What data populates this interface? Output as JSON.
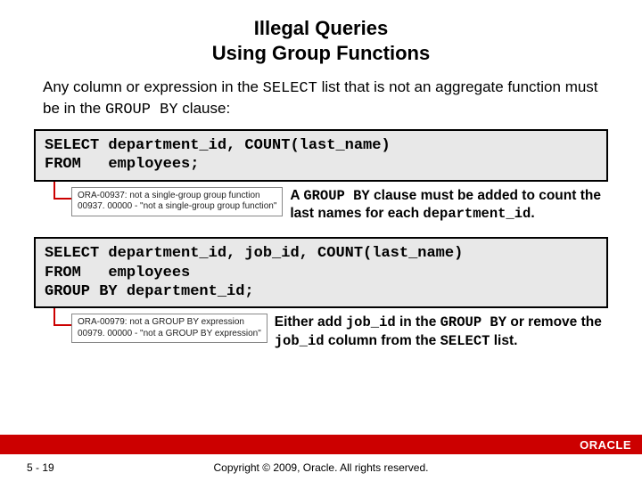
{
  "title_line1": "Illegal Queries",
  "title_line2": "Using Group Functions",
  "intro_pre": "Any column or expression in the ",
  "intro_code1": "SELECT",
  "intro_mid": " list that is not an aggregate function must be in the ",
  "intro_code2": "GROUP BY",
  "intro_post": " clause:",
  "code1": "SELECT department_id, COUNT(last_name)\nFROM   employees;",
  "error1": "ORA-00937: not a single-group group function\n00937. 00000 -  \"not a single-group group function\"",
  "explain1_pre": "A ",
  "explain1_code1": "GROUP BY",
  "explain1_mid": " clause must be added to count the last names for each ",
  "explain1_code2": "department_id",
  "explain1_post": ".",
  "code2": "SELECT department_id, job_id, COUNT(last_name)\nFROM   employees\nGROUP BY department_id;",
  "error2": "ORA-00979: not a GROUP BY expression\n00979. 00000 -  \"not a GROUP BY expression\"",
  "explain2_pre": "Either add ",
  "explain2_code1": "job_id",
  "explain2_mid1": " in the ",
  "explain2_code2": "GROUP BY",
  "explain2_mid2": " or remove the ",
  "explain2_code3": "job_id",
  "explain2_mid3": " column from the ",
  "explain2_code4": "SELECT",
  "explain2_post": " list.",
  "footer_page": "5 - 19",
  "footer_copy": "Copyright © 2009, Oracle. All rights reserved.",
  "logo": "ORACLE"
}
